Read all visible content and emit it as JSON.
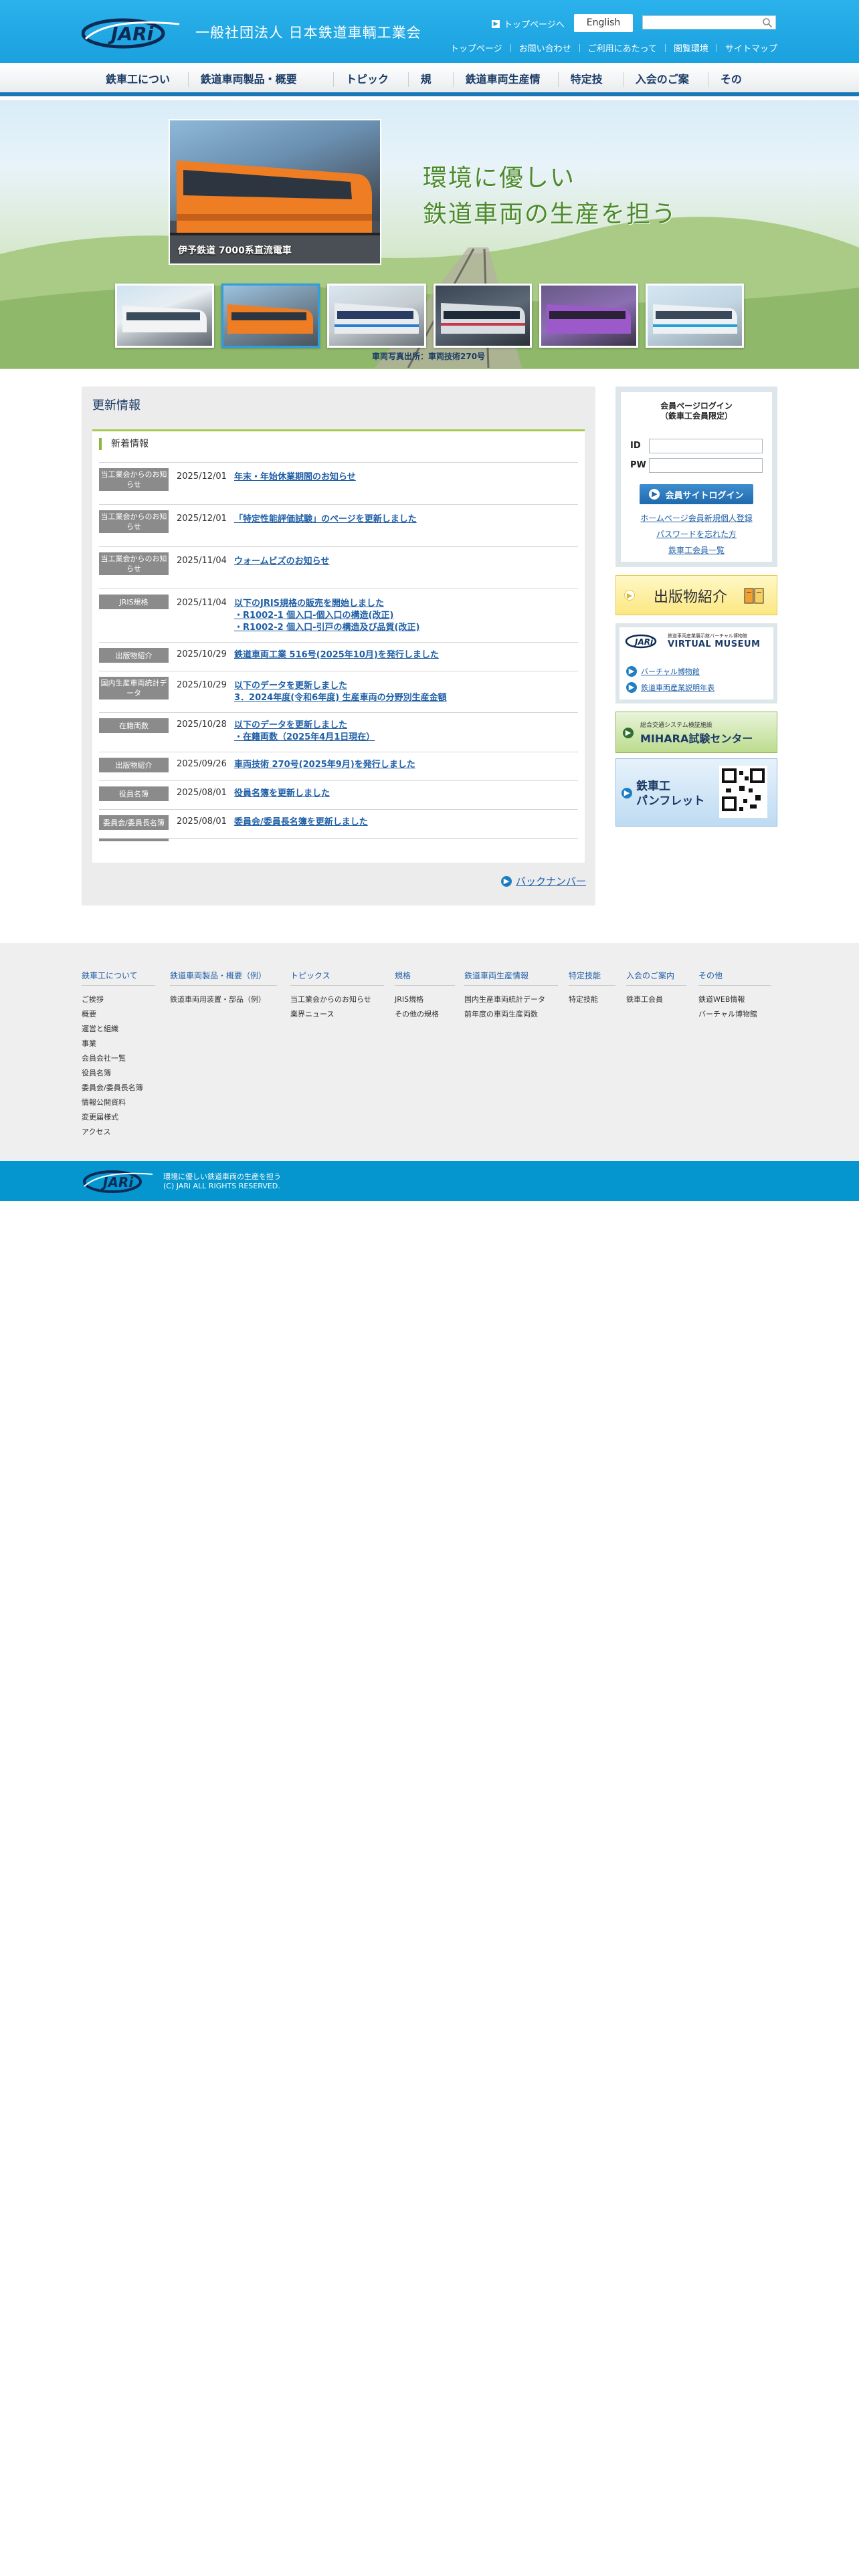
{
  "header": {
    "logo_text": "JARi",
    "org_name": "一般社団法人 日本鉄道車輌工業会",
    "to_top": "トップページへ",
    "english": "English",
    "search_placeholder": "",
    "util_nav": [
      "トップページ",
      "お問い合わせ",
      "ご利用にあたって",
      "閲覧環境",
      "サイトマップ"
    ]
  },
  "gnav": [
    "鉄車工について",
    "鉄道車両製品・概要（例）",
    "トピックス",
    "規格",
    "鉄道車両生産情報",
    "特定技能",
    "入会のご案内",
    "その他"
  ],
  "hero": {
    "caption": "伊予鉄道 7000系直流電車",
    "slogan_line1": "環境に優しい",
    "slogan_line2": "鉄道車両の生産を担う",
    "photo_credit": "車両写真出所：車両技術270号"
  },
  "main": {
    "title": "更新情報",
    "subtitle": "新着情報",
    "news": [
      {
        "cat": "当工業会からのお知らせ",
        "date": "2025/12/01",
        "title": "年末・年始休業期間のお知らせ"
      },
      {
        "cat": "当工業会からのお知らせ",
        "date": "2025/12/01",
        "title": "「特定性能評価試験」のページを更新しました"
      },
      {
        "cat": "当工業会からのお知らせ",
        "date": "2025/11/04",
        "title": "ウォームビズのお知らせ"
      },
      {
        "cat": "JRIS規格",
        "date": "2025/11/04",
        "title": "以下のJRIS規格の販売を開始しました\n・R1002-1 個入口-個入口の構造(改正)\n・R1002-2 個入口-引戸の構造及び品質(改正)"
      },
      {
        "cat": "出版物紹介",
        "date": "2025/10/29",
        "title": "鉄道車両工業 516号(2025年10月)を発行しました"
      },
      {
        "cat": "国内生産車両統計データ",
        "date": "2025/10/29",
        "title": "以下のデータを更新しました\n3．2024年度(令和6年度) 生産車両の分野別生産金額"
      },
      {
        "cat": "在籍両数",
        "date": "2025/10/28",
        "title": "以下のデータを更新しました\n・在籍両数（2025年4月1日現在）"
      },
      {
        "cat": "出版物紹介",
        "date": "2025/09/26",
        "title": "車両技術 270号(2025年9月)を発行しました"
      },
      {
        "cat": "役員名簿",
        "date": "2025/08/01",
        "title": "役員名簿を更新しました"
      },
      {
        "cat": "委員会/委員長名簿",
        "date": "2025/08/01",
        "title": "委員会/委員長名簿を更新しました"
      }
    ],
    "backnumber": "バックナンバー"
  },
  "sidebar": {
    "login_title_1": "会員ページログイン",
    "login_title_2": "（鉄車工会員限定）",
    "id_label": "ID",
    "pw_label": "PW",
    "login_button": "会員サイトログイン",
    "link_register": "ホームページ会員新規個人登録",
    "link_forgot": "パスワードを忘れた方",
    "link_members": "鉄車工会員一覧",
    "pub_banner": "出版物紹介",
    "museum_sub": "鉄道車両産業展示館バーチャル博物館",
    "museum_title": "VIRTUAL MUSEUM",
    "museum_link1": "バーチャル博物館",
    "museum_link2": "鉄道車両産業説明年表",
    "mihara_sub": "総合交通システム検証施設",
    "mihara_title": "MIHARA試験センター",
    "pamph_line1": "鉄車工",
    "pamph_line2": "パンフレット"
  },
  "footer": {
    "columns": [
      {
        "title": "鉄車工について",
        "items": [
          "ご挨拶",
          "概要",
          "運営と組織",
          "事業",
          "会員会社一覧",
          "役員名簿",
          "委員会/委員長名簿",
          "情報公開資料",
          "変更届様式",
          "アクセス"
        ]
      },
      {
        "title": "鉄道車両製品・概要（例）",
        "items": [
          "鉄道車両用装置・部品（例）"
        ]
      },
      {
        "title": "トピックス",
        "items": [
          "当工業会からのお知らせ",
          "業界ニュース"
        ]
      },
      {
        "title": "規格",
        "items": [
          "JRIS規格",
          "その他の規格"
        ]
      },
      {
        "title": "鉄道車両生産情報",
        "items": [
          "国内生産車両統計データ",
          "前年度の車両生産両数"
        ]
      },
      {
        "title": "特定技能",
        "items": [
          "特定技能"
        ]
      },
      {
        "title": "入会のご案内",
        "items": [
          "鉄車工会員"
        ]
      },
      {
        "title": "その他",
        "items": [
          "鉄道WEB情報",
          "バーチャル博物館"
        ]
      }
    ],
    "tagline": "環境に優しい鉄道車両の生産を担う",
    "copyright": "(C) JARi ALL RIGHTS RESERVED."
  },
  "colors": {
    "header_blue": "#1aa1de",
    "nav_dark": "#1878b8",
    "accent_green": "#8ab83b",
    "footer_blue": "#0596cf"
  }
}
